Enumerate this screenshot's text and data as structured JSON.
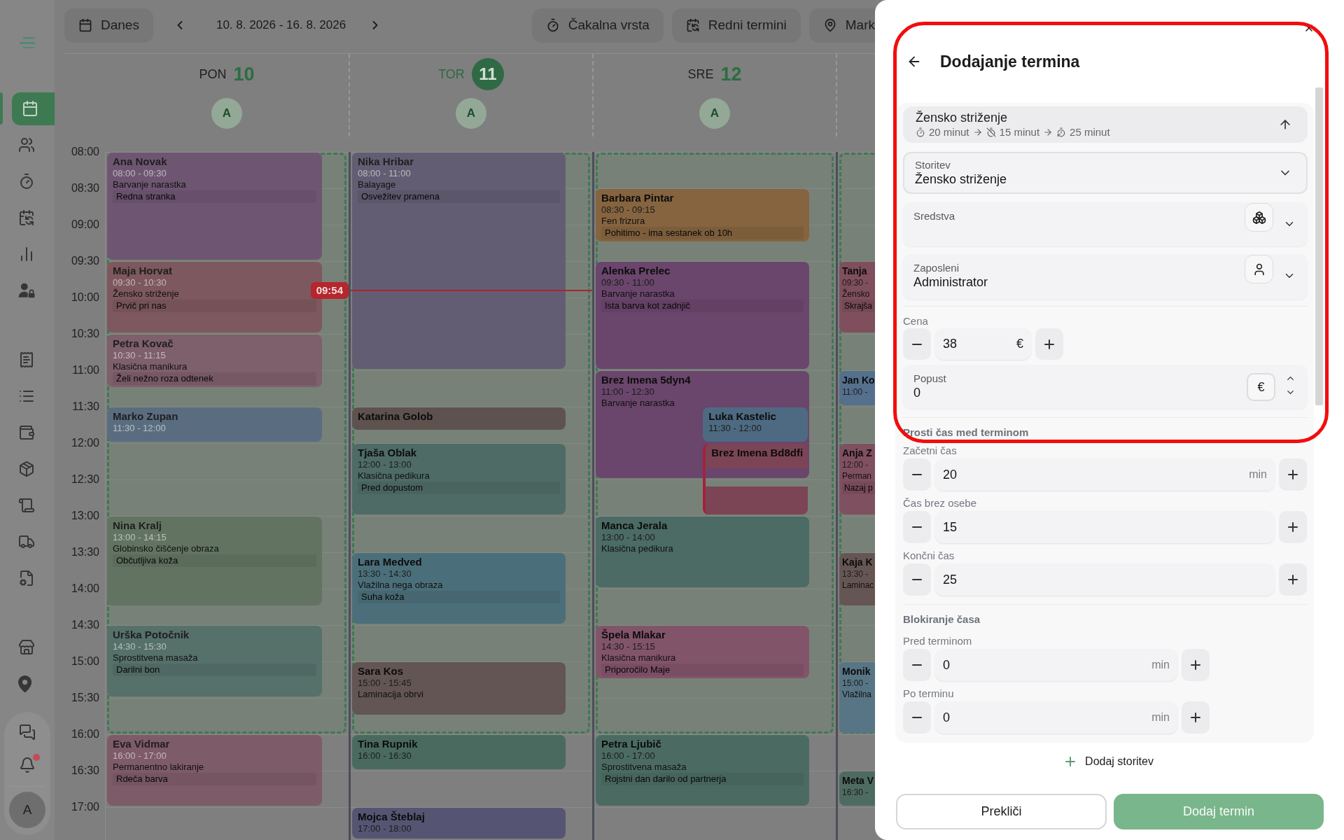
{
  "sidebar": {
    "nav_groups": [
      {
        "items": [
          {
            "selected": true
          },
          {
            "selected": false
          },
          {
            "selected": false
          },
          {
            "selected": false
          },
          {
            "selected": false
          },
          {
            "selected": false
          }
        ]
      },
      {
        "items": [
          {
            "selected": false
          },
          {
            "selected": false
          },
          {
            "selected": false
          },
          {
            "selected": false
          },
          {
            "selected": false
          },
          {
            "selected": false
          },
          {
            "selected": false
          }
        ]
      },
      {
        "items": [
          {
            "selected": false
          },
          {
            "selected": false
          }
        ]
      }
    ],
    "footer": {
      "unread": true,
      "avatar": "A"
    }
  },
  "toolbar": {
    "today_button": "Danes",
    "date_range": "10. 8. 2026 - 16. 8. 2026",
    "buttons": [
      "Čakalna vrsta",
      "Redni termini",
      "Mark"
    ]
  },
  "calendar": {
    "times": [
      "08:00",
      "08:30",
      "09:00",
      "09:30",
      "10:00",
      "10:30",
      "11:00",
      "11:30",
      "12:00",
      "12:30",
      "13:00",
      "13:30",
      "14:00",
      "14:30",
      "15:00",
      "15:30",
      "16:00",
      "16:30",
      "17:00"
    ],
    "now": "09:54",
    "days": [
      {
        "weekday": "PON",
        "day": "10",
        "today": false,
        "staff": "A",
        "events": [
          {
            "kind": "appointment",
            "name": "Ana Novak",
            "time": "08:00 - 09:30",
            "service": "Barvanje narastka",
            "note": "Redna stranka",
            "color": "#6e5672",
            "past": true
          },
          {
            "kind": "appointment",
            "name": "Maja Horvat",
            "time": "09:30 - 10:30",
            "service": "Žensko striženje",
            "note": "Prvič pri nas",
            "color": "#7d585e",
            "past": true
          },
          {
            "kind": "appointment",
            "name": "Petra Kovač",
            "time": "10:30 - 11:15",
            "service": "Klasična manikura",
            "note": "Želi nežno roza odtenek",
            "color": "#7e5f6c",
            "past": true
          },
          {
            "kind": "appointment",
            "name": "Marko Zupan",
            "time": "11:30 - 12:00",
            "color": "#5a6d80",
            "past": true
          },
          {
            "kind": "appointment",
            "name": "Nina Kralj",
            "time": "13:00 - 14:15",
            "service": "Globinsko čiščenje obraza",
            "note": "Občutljiva koža",
            "color": "#627461",
            "past": true
          },
          {
            "kind": "appointment",
            "name": "Urška Potočnik",
            "time": "14:30 - 15:30",
            "service": "Sprostitvena masaža",
            "note": "Darilni bon",
            "color": "#56706a",
            "past": true
          },
          {
            "kind": "appointment",
            "name": "Eva Vidmar",
            "time": "16:00 - 17:00",
            "service": "Permanentno lakiranje",
            "note": "Rdeča barva",
            "color": "#7d5b68",
            "past": true
          }
        ]
      },
      {
        "weekday": "TOR",
        "day": "11",
        "today": true,
        "staff": "A",
        "events": [
          {
            "kind": "appointment",
            "name": "Nika Hribar",
            "time": "08:00 - 11:00",
            "service": "Balayage",
            "note": "Osvežitev pramena",
            "color": "#635d73",
            "past": true
          },
          {
            "kind": "appointment",
            "name": "Katarina Golob",
            "color": "#5e524f",
            "past": false
          },
          {
            "kind": "appointment",
            "name": "Tjaša Oblak",
            "time": "12:00 - 13:00",
            "service": "Klasična pedikura",
            "note": "Pred dopustom",
            "color": "#4e6b66",
            "past": false
          },
          {
            "kind": "appointment",
            "name": "Lara Medved",
            "time": "13:30 - 14:30",
            "service": "Vlažilna nega obraza",
            "note": "Suha koža",
            "color": "#4b6f7a",
            "past": false
          },
          {
            "kind": "appointment",
            "name": "Sara Kos",
            "time": "15:00 - 15:45",
            "service": "Laminacija obrvi",
            "color": "#625553",
            "past": false
          },
          {
            "kind": "appointment",
            "name": "Tina Rupnik",
            "time": "16:00 - 16:30",
            "color": "#4a6a60",
            "past": false
          },
          {
            "kind": "appointment",
            "name": "Mojca Šteblaj",
            "time": "17:00 - 18:00",
            "color": "#555573",
            "past": false
          }
        ]
      },
      {
        "weekday": "SRE",
        "day": "12",
        "today": false,
        "staff": "A",
        "events": [
          {
            "kind": "appointment",
            "name": "Barbara Pintar",
            "time": "08:30 - 09:15",
            "service": "Fen frizura",
            "note": "Pohitimo - ima sestanek ob 10h",
            "color": "#85643f",
            "past": false
          },
          {
            "kind": "appointment",
            "name": "Alenka Prelec",
            "time": "09:30 - 11:00",
            "service": "Barvanje narastka",
            "note": "Ista barva kot zadnjič",
            "color": "#6a456c",
            "past": false
          },
          {
            "kind": "appointment",
            "name": "Brez Imena 5dyn4",
            "time": "11:00 - 12:30",
            "service": "Barvanje narastka",
            "color": "#6a456c",
            "past": false
          },
          {
            "kind": "appointment",
            "name": "Luka Kastelic",
            "time": "11:30 - 12:00",
            "color": "#4e6a82",
            "past": false
          },
          {
            "kind": "conflict",
            "name": "Brez Imena Bd8dfi",
            "color": "#7b4556",
            "past": false
          },
          {
            "kind": "appointment",
            "name": "Manca Jerala",
            "time": "13:00 - 14:00",
            "service": "Klasična pedikura",
            "color": "#4b6b64",
            "past": false
          },
          {
            "kind": "appointment",
            "name": "Špela Mlakar",
            "time": "14:30 - 15:15",
            "service": "Klasična manikura",
            "note": "Priporočilo Maje",
            "color": "#82546a",
            "past": false
          },
          {
            "kind": "appointment",
            "name": "Petra Ljubič",
            "time": "16:00 - 17:00",
            "service": "Sprostitvena masaža",
            "note": "Rojstni dan darilo od partnerja",
            "color": "#4b6b62",
            "past": false
          }
        ]
      },
      {
        "events": [
          {
            "kind": "appointment",
            "name": "Tanja",
            "time": "09:30 -",
            "service": "Žensko",
            "note": "Skrajša",
            "color": "#7f4f5e",
            "past": false
          },
          {
            "kind": "appointment",
            "name": "Jan Ko",
            "time": "11:00 -",
            "color": "#55708d",
            "past": false
          },
          {
            "kind": "appointment",
            "name": "Anja Z",
            "time": "12:00 -",
            "service": "Perman",
            "note": "Nazaj p",
            "color": "#7f5060",
            "past": false
          },
          {
            "kind": "appointment",
            "name": "Kaja K",
            "time": "13:30 -",
            "service": "Laminac",
            "color": "#665653",
            "past": false
          },
          {
            "kind": "appointment",
            "name": "Monik",
            "time": "15:00 -",
            "service": "Vlažilna",
            "color": "#577585",
            "past": false
          },
          {
            "kind": "appointment",
            "name": "Meta V",
            "time": "16:30 -",
            "color": "#4e6b62",
            "past": false
          }
        ]
      }
    ]
  },
  "panel": {
    "title": "Dodajanje termina",
    "service": {
      "name": "Žensko striženje",
      "durations": [
        "20 minut",
        "15 minut",
        "25 minut"
      ],
      "expanded": true
    },
    "fields": [
      {
        "kind": "select",
        "label": "Storitev",
        "value": "Žensko striženje"
      },
      {
        "kind": "resources",
        "label": "Sredstva"
      },
      {
        "kind": "staff",
        "label": "Zaposleni",
        "value": "Administrator"
      }
    ],
    "price": {
      "label": "Cena",
      "value": "38",
      "unit": "€"
    },
    "discount": {
      "label": "Popust",
      "value": "0",
      "unit": "€"
    },
    "sections": [
      {
        "title": "Prosti čas med terminom",
        "steppers": [
          {
            "label": "Začetni čas",
            "value": "20",
            "unit": "min"
          },
          {
            "label": "Čas brez osebe",
            "value": "15"
          },
          {
            "label": "Končni čas",
            "value": "25"
          }
        ]
      },
      {
        "title": "Blokiranje časa",
        "steppers": [
          {
            "label": "Pred terminom",
            "value": "0",
            "unit": "min"
          },
          {
            "label": "Po terminu",
            "value": "0",
            "unit": "min"
          }
        ]
      }
    ],
    "add_service": "Dodaj storitev",
    "actions": [
      {
        "label": "Prekliči",
        "kind": "secondary"
      },
      {
        "label": "Dodaj termin",
        "kind": "primary"
      }
    ]
  },
  "annotation": {
    "kind": "ring"
  }
}
